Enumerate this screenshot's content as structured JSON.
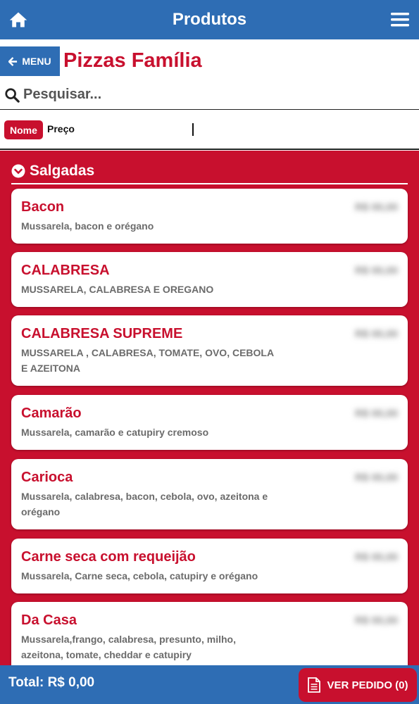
{
  "header": {
    "title": "Produtos",
    "home_icon": "home-icon",
    "menu_icon": "hamburger-icon"
  },
  "subheader": {
    "back_label": "MENU",
    "page_title": "Pizzas Família"
  },
  "search": {
    "placeholder": "Pesquisar..."
  },
  "sort": {
    "name_label": "Nome",
    "price_label": "Preço"
  },
  "category": {
    "title": "Salgadas"
  },
  "products": [
    {
      "name": "Bacon",
      "desc": "Mussarela, bacon e orégano",
      "price": "R$ 00,00"
    },
    {
      "name": "CALABRESA",
      "desc": "MUSSARELA, CALABRESA E OREGANO",
      "price": "R$ 00,00"
    },
    {
      "name": "CALABRESA SUPREME",
      "desc": "MUSSARELA , CALABRESA, TOMATE, OVO, CEBOLA E AZEITONA",
      "price": "R$ 00,00"
    },
    {
      "name": "Camarão",
      "desc": "Mussarela, camarão e catupiry cremoso",
      "price": "R$ 00,00"
    },
    {
      "name": "Carioca",
      "desc": "Mussarela, calabresa, bacon, cebola, ovo, azeitona e orégano",
      "price": "R$ 00,00"
    },
    {
      "name": "Carne seca com requeijão",
      "desc": "Mussarela, Carne seca, cebola, catupiry e orégano",
      "price": "R$ 00,00"
    },
    {
      "name": "Da Casa",
      "desc": "Mussarela,frango, calabresa, presunto, milho, azeitona, tomate, cheddar e catupiry",
      "price": "R$ 00,00"
    }
  ],
  "footer": {
    "total": "Total: R$ 0,00",
    "order_label": "VER PEDIDO (0)"
  },
  "colors": {
    "primary_blue": "#2e6db4",
    "brand_red": "#c8102e"
  }
}
